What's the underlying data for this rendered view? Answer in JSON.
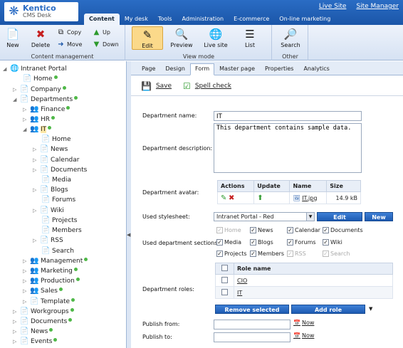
{
  "header": {
    "logo_title": "Kentico",
    "logo_subtitle": "CMS Desk",
    "links": [
      "Live Site",
      "Site Manager"
    ],
    "tabs": [
      "Content",
      "My desk",
      "Tools",
      "Administration",
      "E-commerce",
      "On-line marketing"
    ]
  },
  "ribbon": {
    "content_management": {
      "label": "Content management",
      "new": "New",
      "delete": "Delete",
      "copy": "Copy",
      "move": "Move",
      "up": "Up",
      "down": "Down"
    },
    "view_mode": {
      "label": "View mode",
      "edit": "Edit",
      "preview": "Preview",
      "live_site": "Live site",
      "list": "List"
    },
    "other": {
      "label": "Other",
      "search": "Search"
    }
  },
  "tree": [
    {
      "label": "Intranet Portal",
      "icon": "globe-icon"
    },
    {
      "label": "Home"
    },
    {
      "label": "Company"
    },
    {
      "label": "Departments"
    },
    {
      "label": "Finance"
    },
    {
      "label": "HR"
    },
    {
      "label": "IT"
    },
    {
      "label": "Home"
    },
    {
      "label": "News"
    },
    {
      "label": "Calendar"
    },
    {
      "label": "Documents"
    },
    {
      "label": "Media"
    },
    {
      "label": "Blogs"
    },
    {
      "label": "Forums"
    },
    {
      "label": "Wiki"
    },
    {
      "label": "Projects"
    },
    {
      "label": "Members"
    },
    {
      "label": "RSS"
    },
    {
      "label": "Search"
    },
    {
      "label": "Management"
    },
    {
      "label": "Marketing"
    },
    {
      "label": "Production"
    },
    {
      "label": "Sales"
    },
    {
      "label": "Template"
    },
    {
      "label": "Workgroups"
    },
    {
      "label": "Documents"
    },
    {
      "label": "News"
    },
    {
      "label": "Events"
    }
  ],
  "subtabs": [
    "Page",
    "Design",
    "Form",
    "Master page",
    "Properties",
    "Analytics"
  ],
  "actions": {
    "save": "Save",
    "spell_check": "Spell check"
  },
  "form": {
    "name_label": "Department name:",
    "name_value": "IT",
    "desc_label": "Department description:",
    "desc_value": "This department contains sample data.",
    "avatar_label": "Department avatar:",
    "avatar_headers": [
      "Actions",
      "Update",
      "Name",
      "Size"
    ],
    "avatar_file": "IT.jpg",
    "avatar_size": "14.9 kB",
    "stylesheet_label": "Used stylesheet:",
    "stylesheet_value": "Intranet Portal - Red",
    "edit_btn": "Edit",
    "new_btn": "New",
    "sections_label": "Used department sections:",
    "sections": [
      {
        "label": "Home",
        "checked": true,
        "disabled": true
      },
      {
        "label": "News",
        "checked": true,
        "disabled": false
      },
      {
        "label": "Calendar",
        "checked": true,
        "disabled": false
      },
      {
        "label": "Documents",
        "checked": true,
        "disabled": false
      },
      {
        "label": "Media",
        "checked": true,
        "disabled": false
      },
      {
        "label": "Blogs",
        "checked": true,
        "disabled": false
      },
      {
        "label": "Forums",
        "checked": true,
        "disabled": false
      },
      {
        "label": "Wiki",
        "checked": true,
        "disabled": false
      },
      {
        "label": "Projects",
        "checked": true,
        "disabled": false
      },
      {
        "label": "Members",
        "checked": true,
        "disabled": false
      },
      {
        "label": "RSS",
        "checked": true,
        "disabled": true
      },
      {
        "label": "Search",
        "checked": true,
        "disabled": true
      }
    ],
    "roles_label": "Department roles:",
    "roles_header": "Role name",
    "roles": [
      "CIO",
      "IT"
    ],
    "remove_btn": "Remove selected",
    "add_btn": "Add role",
    "publish_from_label": "Publish from:",
    "publish_to_label": "Publish to:",
    "now": "Now"
  }
}
